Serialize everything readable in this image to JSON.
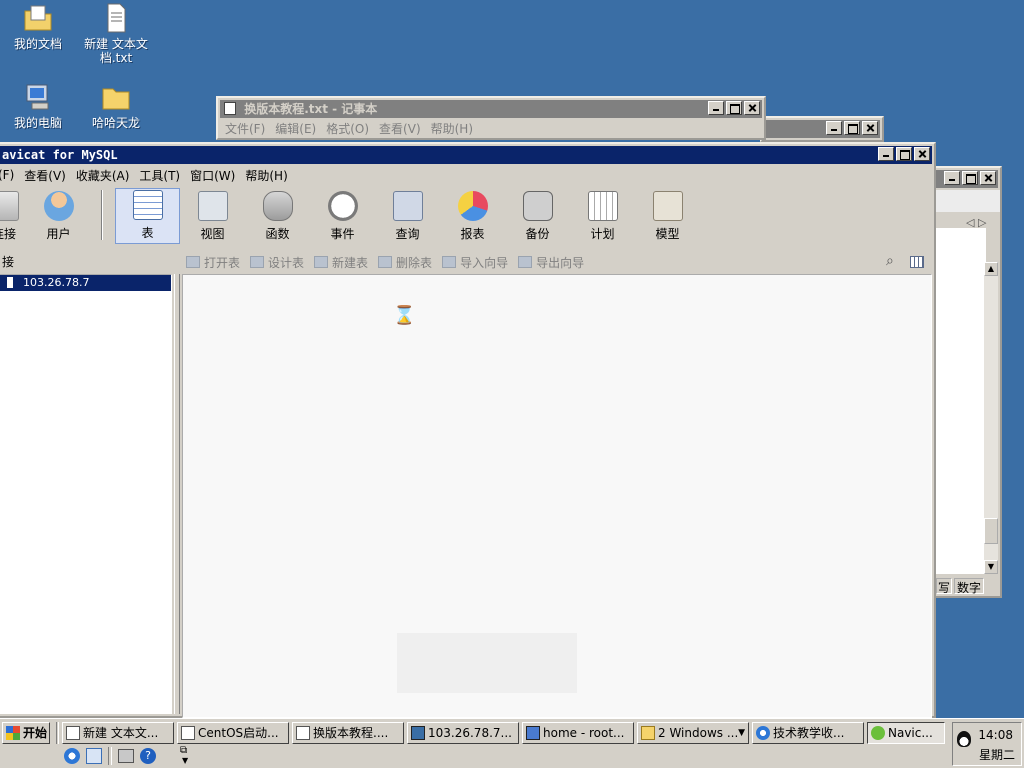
{
  "desktop": {
    "icons": [
      {
        "label": "我的文档"
      },
      {
        "label": "新建 文本文档.txt"
      },
      {
        "label": "我的电脑"
      },
      {
        "label": "哈哈天龙"
      }
    ]
  },
  "notepad": {
    "title": "换版本教程.txt - 记事本",
    "menu": [
      "文件(F)",
      "编辑(E)",
      "格式(O)",
      "查看(V)",
      "帮助(H)"
    ]
  },
  "navicat": {
    "title": "avicat for MySQL",
    "menu": [
      "(F)",
      "查看(V)",
      "收藏夹(A)",
      "工具(T)",
      "窗口(W)",
      "帮助(H)"
    ],
    "toolbar": [
      {
        "label": "连接",
        "icon": "connection-icon"
      },
      {
        "label": "用户",
        "icon": "user-icon"
      },
      {
        "label": "表",
        "icon": "table-icon"
      },
      {
        "label": "视图",
        "icon": "view-icon"
      },
      {
        "label": "函数",
        "icon": "function-icon"
      },
      {
        "label": "事件",
        "icon": "event-icon"
      },
      {
        "label": "查询",
        "icon": "query-icon"
      },
      {
        "label": "报表",
        "icon": "report-icon"
      },
      {
        "label": "备份",
        "icon": "backup-icon"
      },
      {
        "label": "计划",
        "icon": "schedule-icon"
      },
      {
        "label": "模型",
        "icon": "model-icon"
      }
    ],
    "sub_toolbar": [
      "打开表",
      "设计表",
      "新建表",
      "删除表",
      "导入向导",
      "导出向导"
    ],
    "left_header": "接",
    "connection": "103.26.78.7"
  },
  "right_window": {
    "status": [
      "写",
      "数字"
    ]
  },
  "taskbar": {
    "start_label": "开始",
    "tasks": [
      "新建 文本文...",
      "CentOS启动...",
      "换版本教程....",
      "103.26.78.7...",
      "home - root...",
      "2 Windows ...",
      "技术教学收...",
      "Navic..."
    ],
    "clock_time": "14:08",
    "clock_day": "星期二"
  },
  "colors": {
    "desktop": "#3a6ea5",
    "active_title": "#0a246a",
    "inactive_title": "#808080",
    "selection": "#0a246a"
  }
}
